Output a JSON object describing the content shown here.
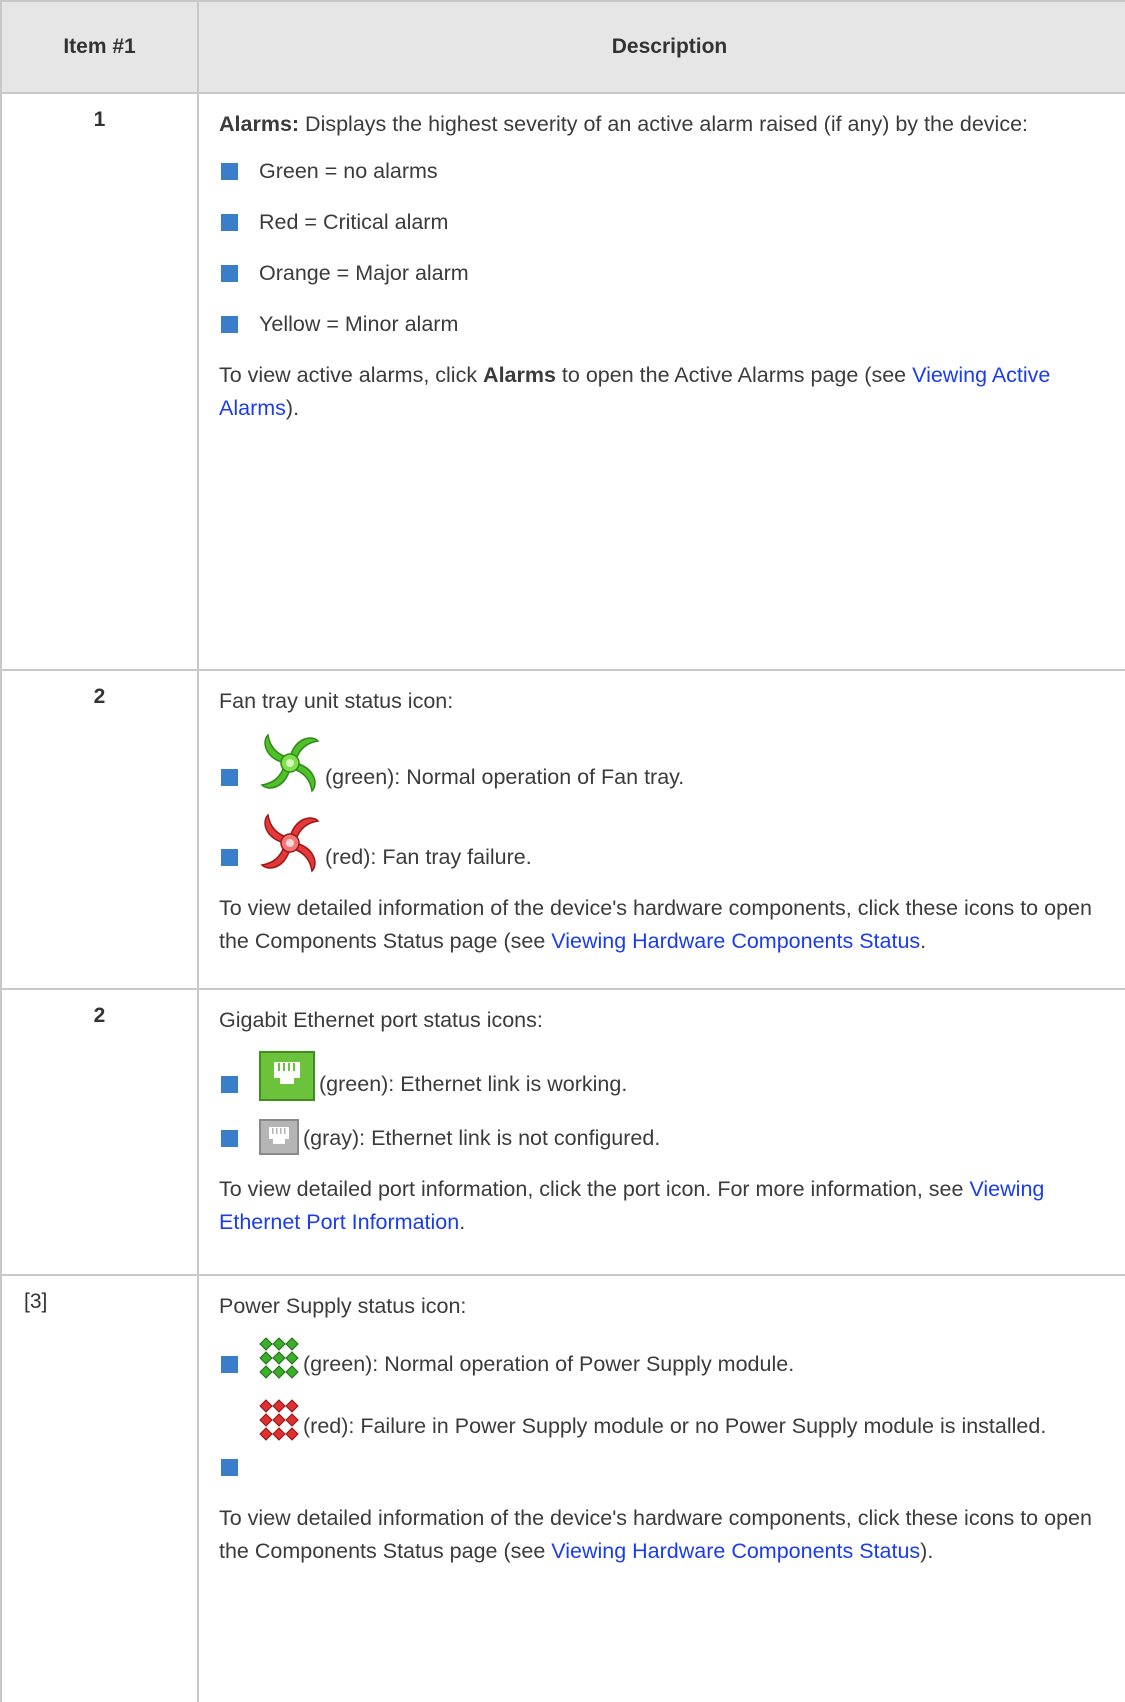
{
  "table": {
    "headers": [
      "Item #1",
      "Description"
    ],
    "rows": [
      {
        "item": "1",
        "intro_bold": "Alarms:",
        "intro_text": " Displays the highest severity of an active alarm raised (if any) by the device:",
        "bullets": [
          "Green = no alarms",
          "Red = Critical alarm",
          "Orange = Major alarm",
          "Yellow = Minor alarm"
        ],
        "footer_pre": "To view active alarms, click ",
        "footer_bold": "Alarms",
        "footer_mid": " to open the Active Alarms page (see ",
        "footer_link": "Viewing Active Alarms",
        "footer_post": ")."
      },
      {
        "item": "2",
        "intro": "Fan tray unit status icon:",
        "bullets": [
          {
            "icon": "fan-green-icon",
            "text": "(green): Normal operation of Fan tray."
          },
          {
            "icon": "fan-red-icon",
            "text": "(red): Fan tray failure."
          }
        ],
        "footer_pre": "To view detailed information of the device's hardware components, click these icons to open the Components Status page (see ",
        "footer_link": "Viewing Hardware Components Status",
        "footer_post": "."
      },
      {
        "item": "2",
        "intro": "Gigabit Ethernet port status icons:",
        "bullets": [
          {
            "icon": "ethernet-port-green-icon",
            "text": "(green): Ethernet link is working."
          },
          {
            "icon": "ethernet-port-gray-icon",
            "text": "(gray): Ethernet link is not configured."
          }
        ],
        "footer_pre": "To view detailed port information, click the port icon. For more information, see ",
        "footer_link": "Viewing Ethernet Port Information",
        "footer_post": "."
      },
      {
        "item": "[3]",
        "intro": "Power Supply status icon:",
        "bullets": [
          {
            "icon": "power-supply-green-icon",
            "text": "(green): Normal operation of Power Supply module."
          },
          {
            "icon": "power-supply-red-icon",
            "text": "(red): Failure in Power Supply module or no Power Supply module is installed."
          }
        ],
        "footer_pre": "To view detailed information of the device's hardware components, click these icons to open the Components Status page (see ",
        "footer_link": "Viewing Hardware Components Status",
        "footer_post": ")."
      }
    ]
  },
  "colors": {
    "bullet": "#3a7dc9",
    "link": "#1a3cf0",
    "header_bg": "#e6e6e6",
    "border": "#c8c8c8"
  }
}
